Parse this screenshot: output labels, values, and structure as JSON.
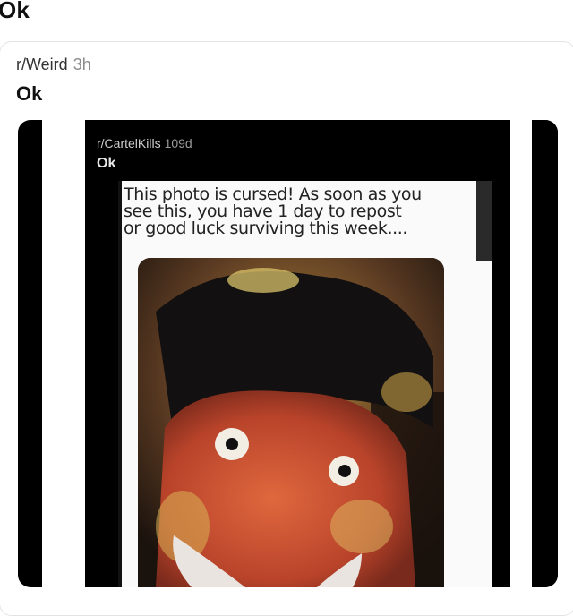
{
  "header": {
    "title": "Ok"
  },
  "post": {
    "subreddit": "r/Weird",
    "age": "3h",
    "title": "Ok"
  },
  "embedded": {
    "subreddit": "r/CartelKills",
    "age": "109d",
    "title": "Ok",
    "caption_lines": [
      "This photo is cursed! As soon as you",
      "see this, you have 1 day to repost",
      "or good luck surviving this week...."
    ]
  }
}
